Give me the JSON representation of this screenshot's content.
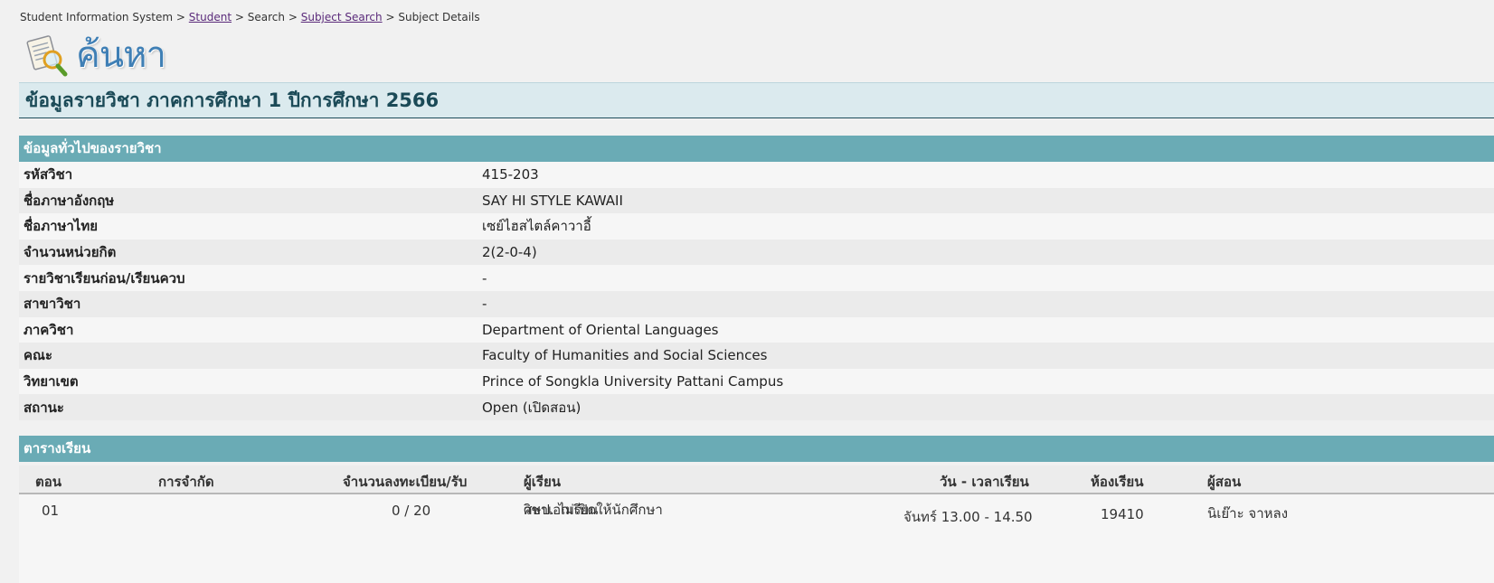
{
  "breadcrumb": {
    "root": "Student Information System",
    "student": "Student",
    "search": "Search",
    "subject_search": "Subject Search",
    "current": "Subject Details",
    "sep": ">"
  },
  "logo": {
    "text": "ค้นหา"
  },
  "page_title": "ข้อมูลรายวิชา ภาคการศึกษา 1 ปีการศึกษา 2566",
  "general_section": {
    "header": "ข้อมูลทั่วไปของรายวิชา",
    "rows": [
      {
        "label": "รหัสวิชา",
        "value": "415-203"
      },
      {
        "label": "ชื่อภาษาอังกฤษ",
        "value": "SAY HI STYLE KAWAII"
      },
      {
        "label": "ชื่อภาษาไทย",
        "value": "เซย์ไฮสไตล์คาวาอี้"
      },
      {
        "label": "จำนวนหน่วยกิต",
        "value": "2(2-0-4)"
      },
      {
        "label": "รายวิชาเรียนก่อน/เรียนควบ",
        "value": "-"
      },
      {
        "label": "สาขาวิชา",
        "value": "-"
      },
      {
        "label": "ภาควิชา",
        "value": "Department of Oriental Languages"
      },
      {
        "label": "คณะ",
        "value": "Faculty of Humanities and Social Sciences"
      },
      {
        "label": "วิทยาเขต",
        "value": "Prince of Songkla University Pattani Campus"
      },
      {
        "label": "สถานะ",
        "value": "Open (เปิดสอน)"
      }
    ]
  },
  "schedule_section": {
    "header": "ตารางเรียน",
    "columns": {
      "section": "ตอน",
      "restriction": "การจำกัด",
      "enrolled": "จำนวนลงทะเบียน/รับ",
      "learners": "ผู้เรียน",
      "time": "วัน - เวลาเรียน",
      "room": "ห้องเรียน",
      "instructor": "ผู้สอน"
    },
    "rows": [
      {
        "section": "01",
        "restriction": "",
        "enrolled": "0 / 20",
        "learners_line1": "ศษป. ไม่เปิดให้นักศึกษา",
        "learners_line2": "วิชาเอกเรียน",
        "time": "จันทร์ 13.00 - 14.50",
        "room": "19410",
        "instructor": "นิเย๊าะ จาหลง"
      }
    ]
  },
  "colors": {
    "section_header_bg": "#6aabb5",
    "title_bar_bg": "#dbeaee",
    "title_text": "#1b4a57",
    "link": "#5a2a7a",
    "logo_text": "#3f7fb5"
  },
  "icons": {
    "logo": "search-document-magnifier-icon"
  }
}
